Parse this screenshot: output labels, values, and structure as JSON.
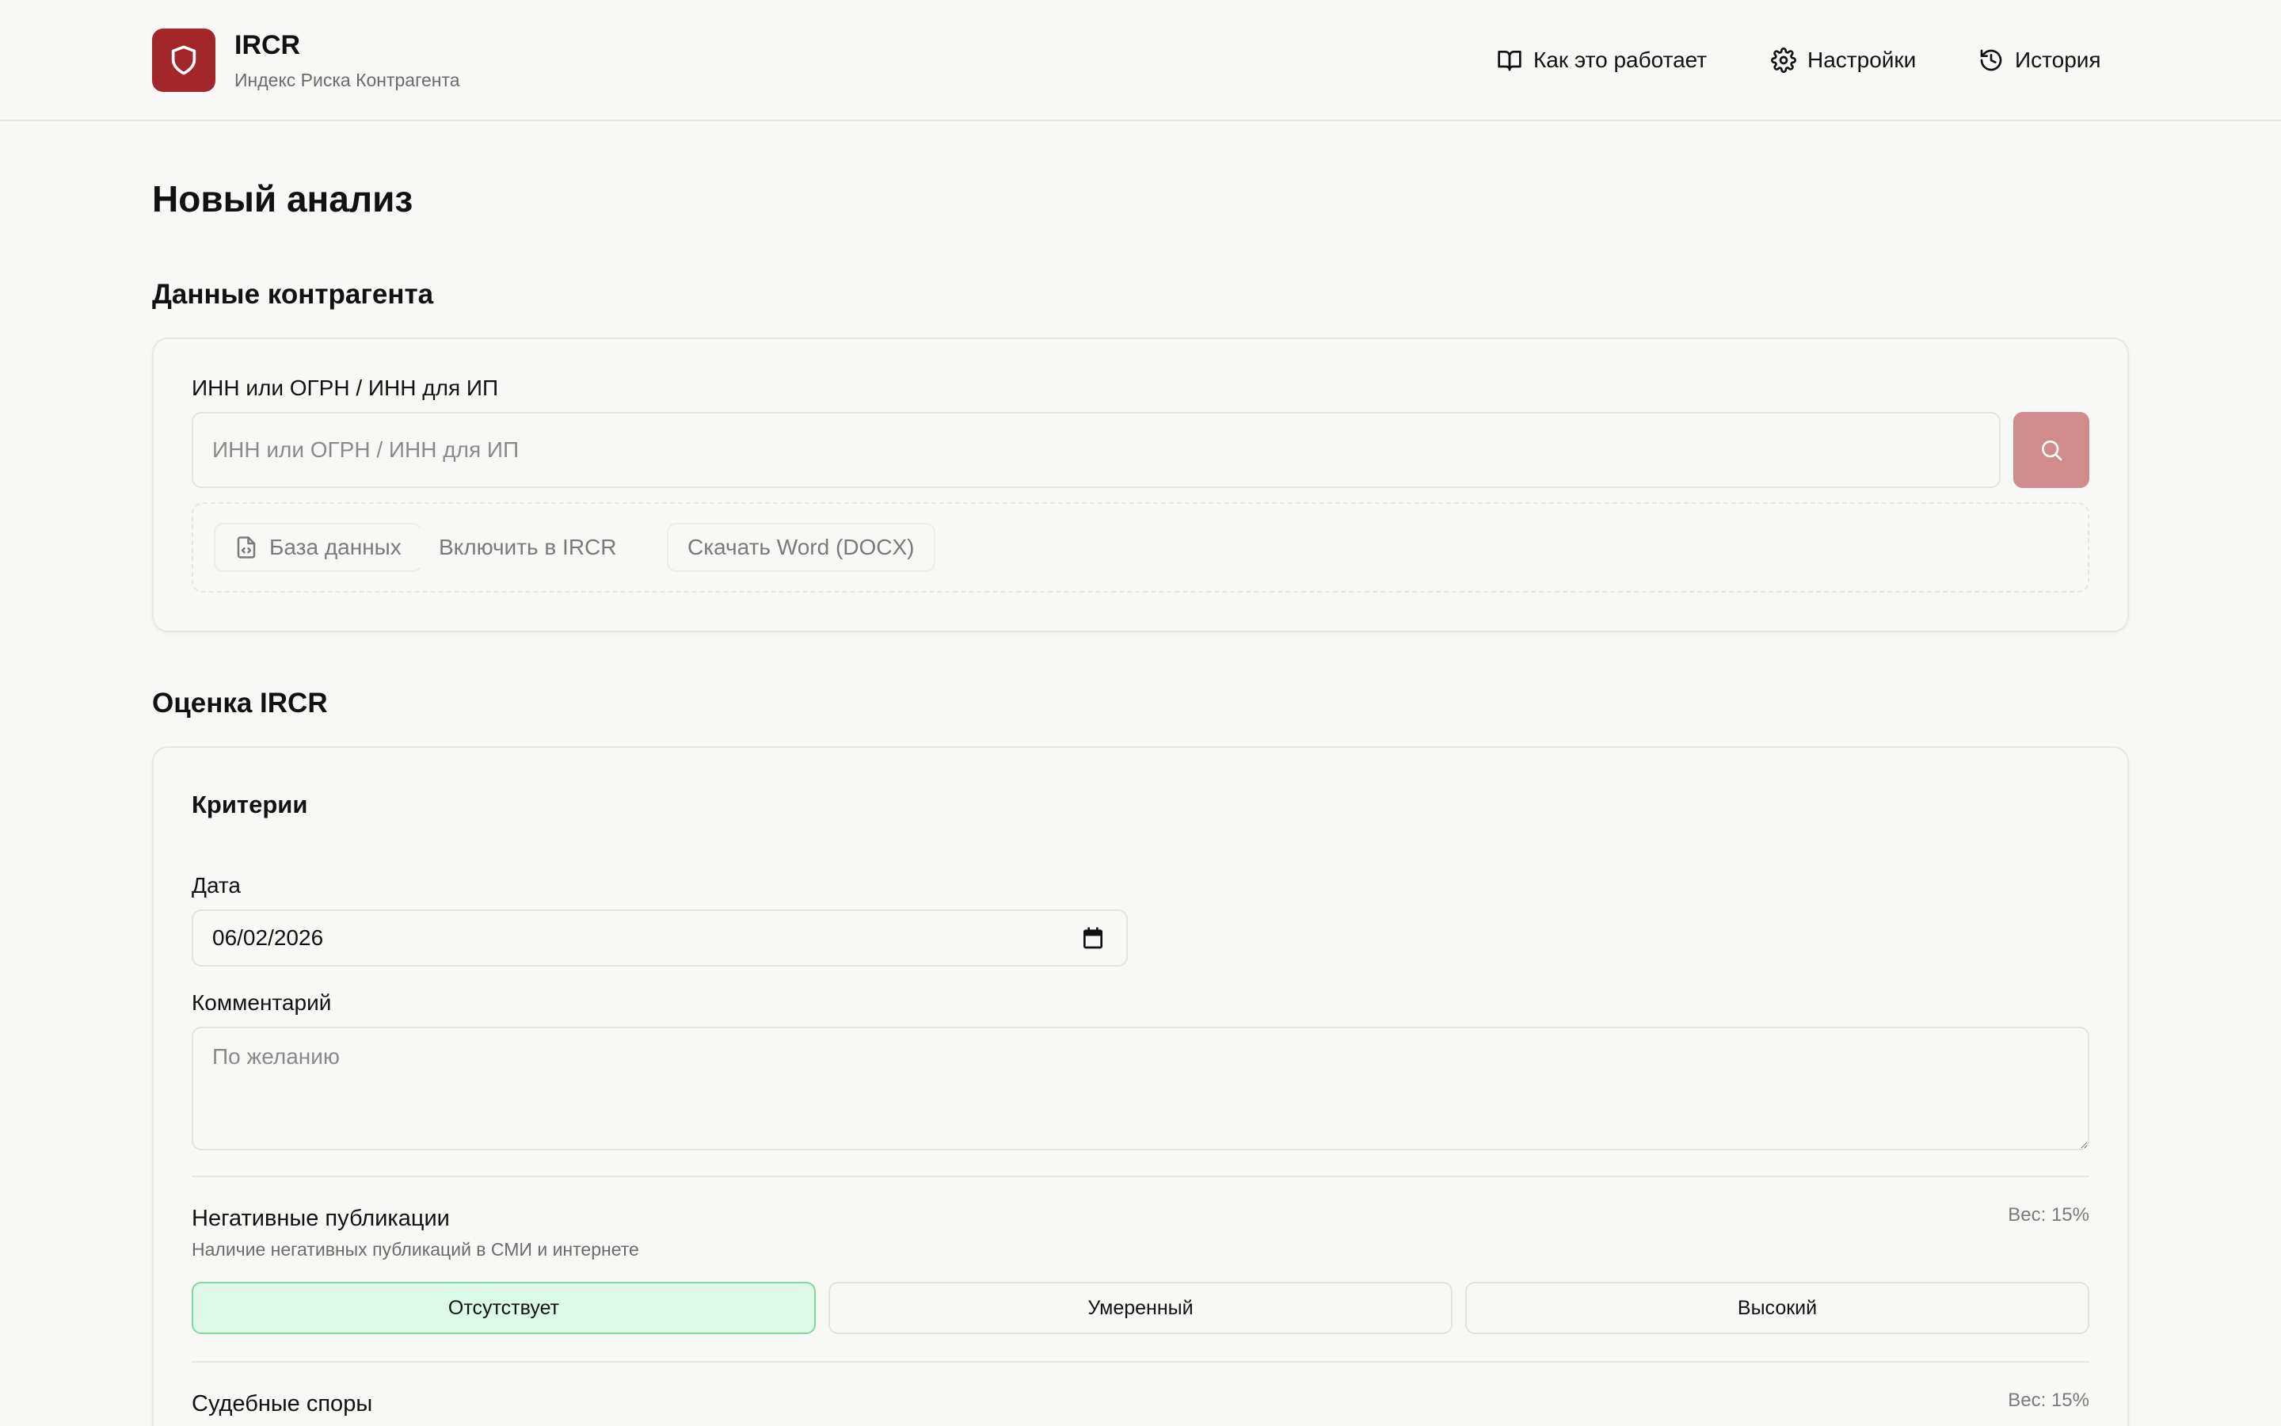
{
  "header": {
    "brand_title": "IRCR",
    "brand_subtitle": "Индекс Риска Контрагента",
    "nav": [
      {
        "label": "Как это работает",
        "icon": "book-icon"
      },
      {
        "label": "Настройки",
        "icon": "gear-icon"
      },
      {
        "label": "История",
        "icon": "history-icon"
      }
    ]
  },
  "page": {
    "title": "Новый анализ"
  },
  "counterparty": {
    "section_title": "Данные контрагента",
    "field_label": "ИНН или ОГРН / ИНН для ИП",
    "field_placeholder": "ИНН или ОГРН / ИНН для ИП",
    "field_value": "",
    "actions": [
      {
        "label": "База данных",
        "icon": "file-code-icon"
      },
      {
        "label": "Включить в IRCR"
      },
      {
        "label": "Скачать Word (DOCX)"
      }
    ]
  },
  "assessment": {
    "section_title": "Оценка IRCR",
    "card_title": "Критерии",
    "date_label": "Дата",
    "date_value": "2026-06-02",
    "comment_label": "Комментарий",
    "comment_placeholder": "По желанию",
    "criteria": [
      {
        "title": "Негативные публикации",
        "description": "Наличие негативных публикаций в СМИ и интернете",
        "weight": "Вес: 15%",
        "options": [
          "Отсутствует",
          "Умеренный",
          "Высокий"
        ],
        "selected": "Отсутствует"
      },
      {
        "title": "Судебные споры",
        "weight": "Вес: 15%"
      }
    ]
  },
  "colors": {
    "brand": "#a3262a",
    "search_button": "#d08c8c",
    "selected_option_bg": "#dcf9e6",
    "selected_option_border": "#7fd99e"
  }
}
